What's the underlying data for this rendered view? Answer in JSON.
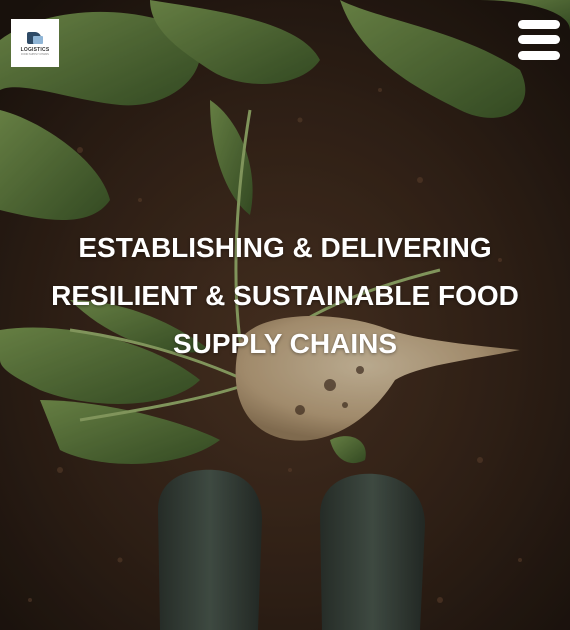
{
  "header": {
    "logo": {
      "text": "LOGISTICS",
      "tagline": "FOOD SUPPLY CHAINS",
      "icon": "logo-truck-mark"
    },
    "menu": {
      "icon": "hamburger-menu-icon"
    }
  },
  "hero": {
    "headline": "ESTABLISHING & DELIVERING RESILIENT & SUSTAINABLE FOOD SUPPLY CHAINS",
    "background_description_icon": "soil-beet-boots-photo"
  },
  "colors": {
    "soil_dark": "#2a1c13",
    "leaf_green": "#5e7a3e",
    "beet": "#cdb595",
    "boot": "#3e4740",
    "text": "#ffffff"
  }
}
